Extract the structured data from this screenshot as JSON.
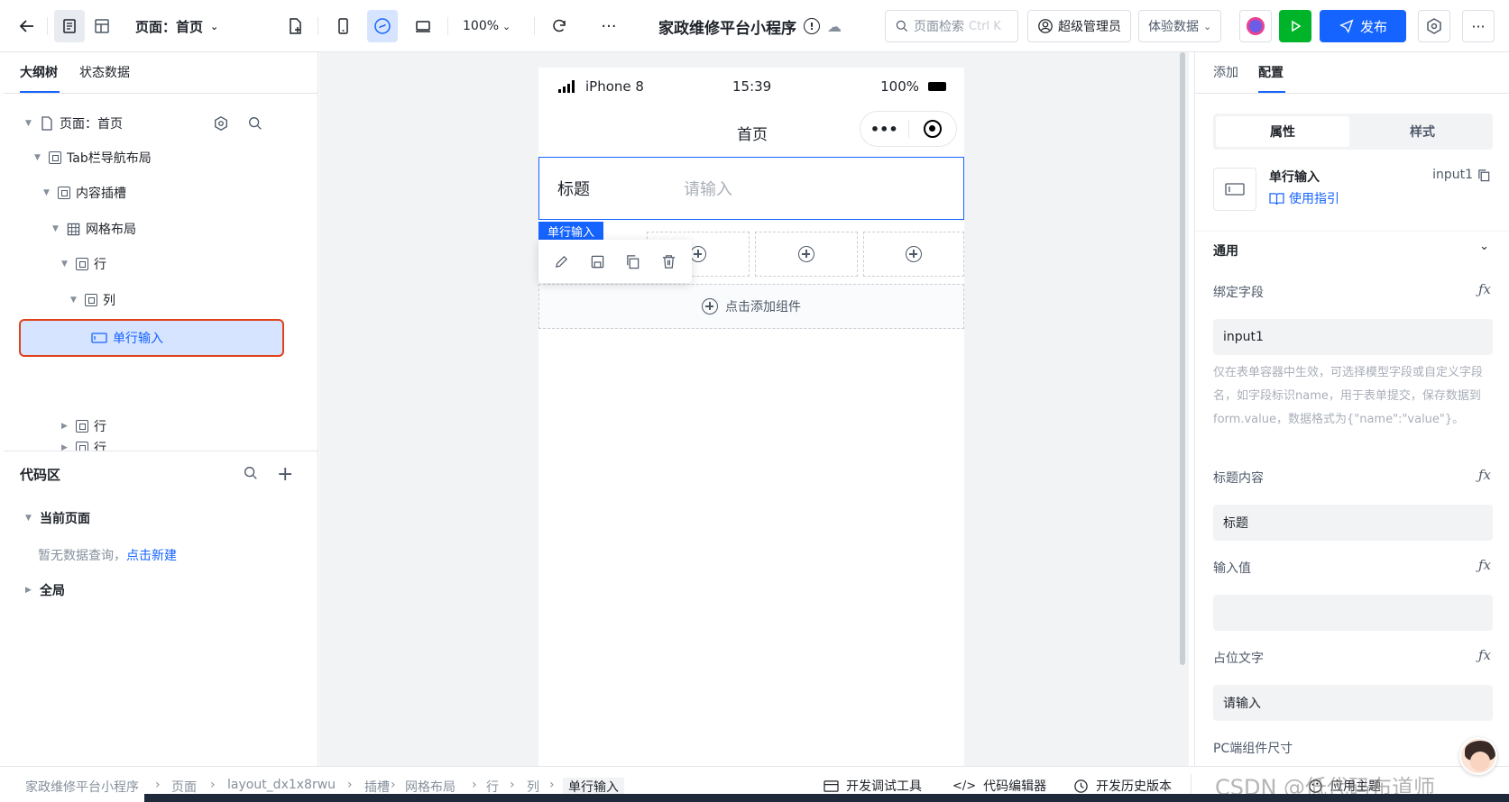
{
  "topbar": {
    "page_select": "页面：首页",
    "zoom": "100%",
    "app_title": "家政维修平台小程序",
    "search_placeholder": "页面检索",
    "search_shortcut": "Ctrl K",
    "user": "超级管理员",
    "data_env": "体验数据",
    "publish": "发布",
    "more": "···"
  },
  "left": {
    "tabs": [
      "大纲树",
      "状态数据"
    ],
    "tree": [
      "页面：首页",
      "Tab栏导航布局",
      "内容插槽",
      "网格布局",
      "行",
      "列",
      "单行输入",
      "行",
      "行"
    ],
    "code": {
      "title": "代码区",
      "current": "当前页面",
      "empty": "暂无数据查询，",
      "create": "点击新建",
      "global": "全局"
    }
  },
  "phone": {
    "device": "iPhone 8",
    "time": "15:39",
    "battery": "100%",
    "nav_title": "首页",
    "input_label": "标题",
    "input_placeholder": "请输入",
    "tag": "单行输入",
    "add": "点击添加组件"
  },
  "right": {
    "tabs": [
      "添加",
      "配置"
    ],
    "seg": [
      "属性",
      "样式"
    ],
    "comp_name": "单行输入",
    "comp_id": "input1",
    "guide": "使用指引",
    "section": "通用",
    "bind_label": "绑定字段",
    "bind_value": "input1",
    "bind_help": "仅在表单容器中生效，可选择模型字段或自定义字段名，如字段标识name，用于表单提交，保存数据到form.value，数据格式为{\"name\":\"value\"}。",
    "title_label": "标题内容",
    "title_value": "标题",
    "value_label": "输入值",
    "value_value": "",
    "ph_label": "占位文字",
    "ph_value": "请输入",
    "pc_label": "PC端组件尺寸"
  },
  "status": {
    "crumbs": [
      "家政维修平台小程序",
      "页面",
      "layout_dx1x8rwu",
      "插槽",
      "网格布局",
      "行",
      "列",
      "单行输入"
    ],
    "debug": "开发调试工具",
    "code_editor": "代码编辑器",
    "history": "开发历史版本",
    "theme": "应用主题",
    "watermark": "CSDN @低代码布道师"
  },
  "colors": {
    "primary": "#1664ff",
    "green": "#00b42a",
    "select_bg": "#d6e4ff",
    "select_border": "#e0421b"
  }
}
